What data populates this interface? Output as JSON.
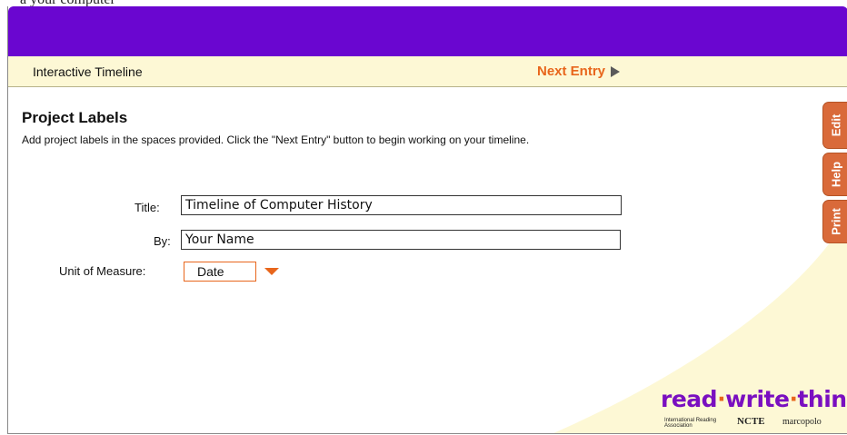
{
  "page_top_text": "a your computer",
  "nav": {
    "title": "Interactive Timeline",
    "next_entry": "Next Entry"
  },
  "content": {
    "heading": "Project Labels",
    "instructions": "Add project labels in the spaces provided. Click the \"Next Entry\" button to begin working on your timeline.",
    "title_label": "Title:",
    "title_value": "Timeline of Computer History",
    "by_label": "By:",
    "by_value": "Your Name",
    "unit_label": "Unit of Measure:",
    "unit_value": "Date"
  },
  "side_tabs": {
    "edit": "Edit",
    "help": "Help",
    "print": "Print"
  },
  "logo": {
    "word1": "read",
    "word2": "write",
    "word3": "think",
    "sep": "·",
    "partner1": "International Reading Association",
    "partner2": "NCTE",
    "partner3": "marcopolo"
  },
  "colors": {
    "header": "#6a06d0",
    "accent": "#e8661c",
    "nav_bg": "#fdf8d5",
    "tab": "#d96a3a"
  }
}
